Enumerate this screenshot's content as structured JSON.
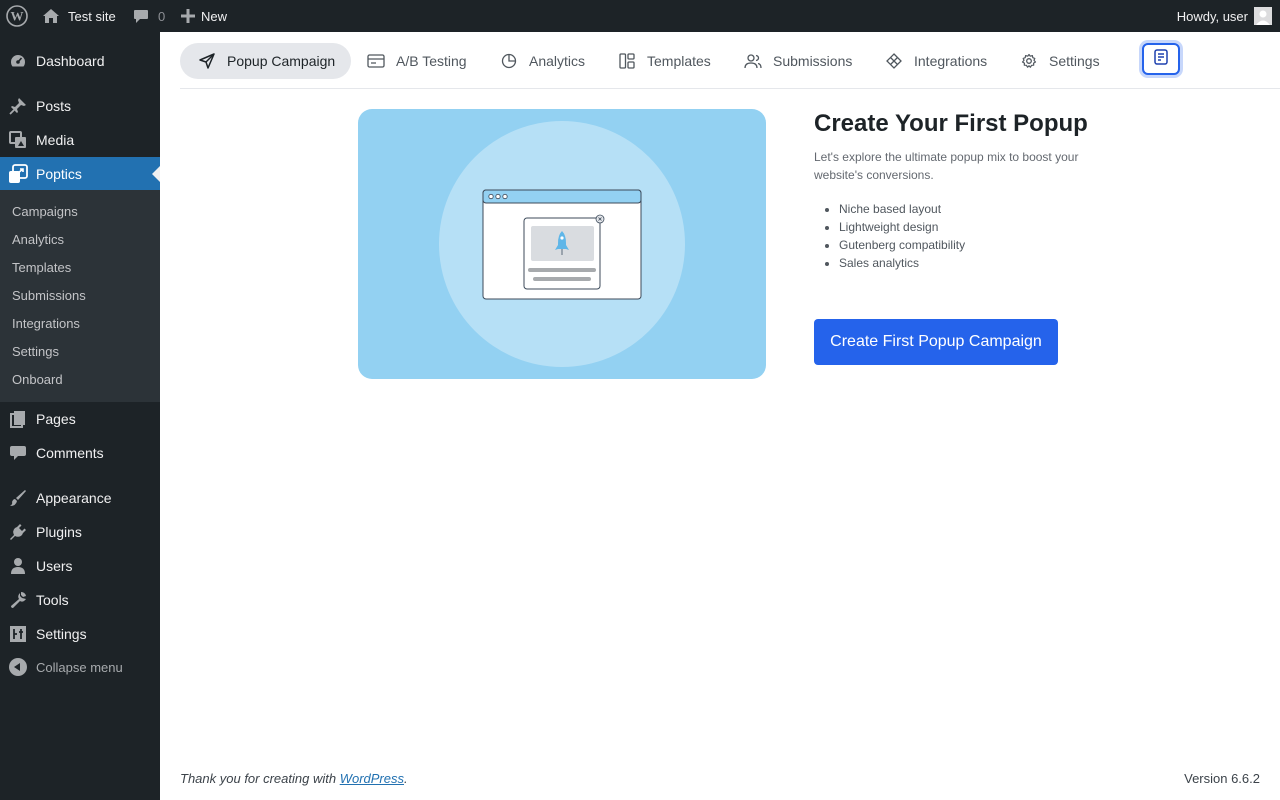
{
  "adminbar": {
    "site_name": "Test site",
    "comments_count": "0",
    "new_label": "New",
    "howdy": "Howdy, user"
  },
  "sidebar": {
    "items": [
      {
        "label": "Dashboard",
        "icon": "dashboard-icon"
      },
      {
        "label": "Posts",
        "icon": "pin-icon"
      },
      {
        "label": "Media",
        "icon": "media-icon"
      },
      {
        "label": "Poptics",
        "icon": "poptics-icon",
        "current": true
      },
      {
        "label": "Pages",
        "icon": "pages-icon"
      },
      {
        "label": "Comments",
        "icon": "comment-icon"
      },
      {
        "label": "Appearance",
        "icon": "brush-icon"
      },
      {
        "label": "Plugins",
        "icon": "plugin-icon"
      },
      {
        "label": "Users",
        "icon": "user-icon"
      },
      {
        "label": "Tools",
        "icon": "wrench-icon"
      },
      {
        "label": "Settings",
        "icon": "settings-icon"
      }
    ],
    "submenu": [
      "Campaigns",
      "Analytics",
      "Templates",
      "Submissions",
      "Integrations",
      "Settings",
      "Onboard"
    ],
    "collapse_label": "Collapse menu"
  },
  "tabs": [
    {
      "label": "Popup Campaign",
      "icon": "send-icon",
      "active": true
    },
    {
      "label": "A/B Testing",
      "icon": "card-icon"
    },
    {
      "label": "Analytics",
      "icon": "pie-chart-icon"
    },
    {
      "label": "Templates",
      "icon": "layout-icon"
    },
    {
      "label": "Submissions",
      "icon": "users-icon"
    },
    {
      "label": "Integrations",
      "icon": "diamond-icon"
    },
    {
      "label": "Settings",
      "icon": "gear-icon"
    }
  ],
  "hero": {
    "title": "Create Your First Popup",
    "description": "Let's explore the ultimate popup mix to boost your website's conversions.",
    "features": [
      "Niche based layout",
      "Lightweight design",
      "Gutenberg compatibility",
      "Sales analytics"
    ],
    "cta": "Create First Popup Campaign"
  },
  "footer": {
    "thanks_prefix": "Thank you for creating with ",
    "thanks_link": "WordPress",
    "thanks_suffix": ".",
    "version": "Version 6.6.2"
  },
  "colors": {
    "admin_dark": "#1d2327",
    "wp_blue": "#2271b1",
    "cta_blue": "#2563eb",
    "hero_bg": "#93d1f2"
  }
}
